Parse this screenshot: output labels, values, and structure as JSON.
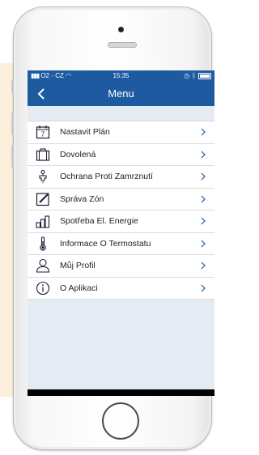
{
  "colors": {
    "accent": "#1d5aa0",
    "icon": "#1d1d3a",
    "chevron": "#1d5aa0"
  },
  "status": {
    "carrier": "O2 - CZ",
    "time": "15:35"
  },
  "nav": {
    "title": "Menu"
  },
  "menu": [
    {
      "label": "Nastavit Plán",
      "icon": "calendar-icon"
    },
    {
      "label": "Dovolená",
      "icon": "suitcase-icon"
    },
    {
      "label": "Ochrana Proti Zamrznutí",
      "icon": "faucet-icon"
    },
    {
      "label": "Správa Zón",
      "icon": "edit-icon"
    },
    {
      "label": "Spotřeba El. Energie",
      "icon": "bar-chart-icon"
    },
    {
      "label": "Informace O Termostatu",
      "icon": "thermometer-icon"
    },
    {
      "label": "Můj Profil",
      "icon": "user-icon"
    },
    {
      "label": "O Aplikaci",
      "icon": "info-icon"
    }
  ]
}
